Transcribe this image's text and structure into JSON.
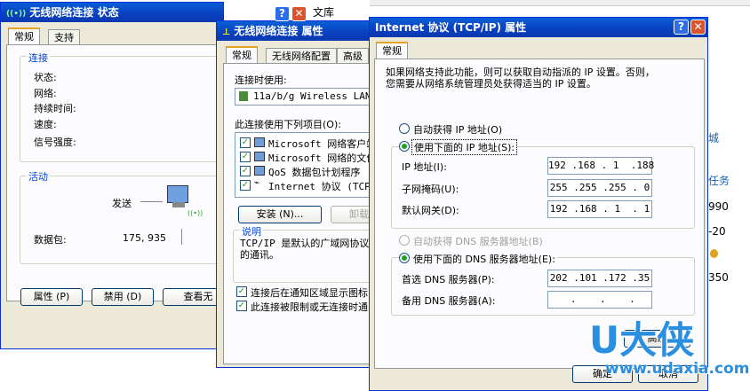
{
  "background": {
    "library_link": "文库",
    "right_items": [
      "城",
      "任务",
      "990",
      "-20",
      "350"
    ]
  },
  "status_window": {
    "title": "无线网络连接 状态",
    "tabs": [
      "常规",
      "支持"
    ],
    "connection_group": "连接",
    "labels": [
      "状态:",
      "网络:",
      "持续时间:",
      "速度:",
      "信号强度:"
    ],
    "activity_group": "活动",
    "sent_label": "发送",
    "packets_label": "数据包:",
    "packets_value": "175, 935",
    "buttons": {
      "properties": "属性 (P)",
      "disable": "禁用 (D)",
      "view": "查看无"
    }
  },
  "props_window": {
    "title": "无线网络连接 属性",
    "tabs": [
      "常规",
      "无线网络配置",
      "高级"
    ],
    "connect_using_label": "连接时使用:",
    "adapter_name": "11a/b/g Wireless LAN",
    "items_label": "此连接使用下列项目(O):",
    "items": [
      "Microsoft 网络客户端",
      "Microsoft 网络的文件",
      "QoS 数据包计划程序",
      "Internet 协议 (TCP/"
    ],
    "install_button": "安装 (N)...",
    "uninstall_button": "卸载",
    "description_group": "说明",
    "description": "TCP/IP 是默认的广域网协议\n的通讯。",
    "check_show_icon": "连接后在通知区域显示图标",
    "check_notify": "此连接被限制或无连接时通"
  },
  "tcpip_window": {
    "title": "Internet 协议 (TCP/IP) 属性",
    "tab": "常规",
    "intro": "如果网络支持此功能，则可以获取自动指派的 IP 设置。否则，\n您需要从网络系统管理员处获得适当的 IP 设置。",
    "auto_ip": "自动获得 IP 地址(O)",
    "use_ip": "使用下面的 IP 地址(S):",
    "ip_label": "IP 地址(I):",
    "ip_value": "192 .168 . 1  .188",
    "mask_label": "子网掩码(U):",
    "mask_value": "255 .255 .255 . 0",
    "gateway_label": "默认网关(D):",
    "gateway_value": "192 .168 . 1  . 1",
    "auto_dns": "自动获得 DNS 服务器地址(B)",
    "use_dns": "使用下面的 DNS 服务器地址(E):",
    "dns1_label": "首选 DNS 服务器(P):",
    "dns1_value": "202 .101 .172 .35",
    "dns2_label": "备用 DNS 服务器(A):",
    "dns2_value": " .    .    .",
    "advanced_button": "高级",
    "ok_button": "确定",
    "cancel_button": "取消"
  },
  "watermark": {
    "logo_text": "U大侠",
    "url": "www.udaxia.com"
  }
}
